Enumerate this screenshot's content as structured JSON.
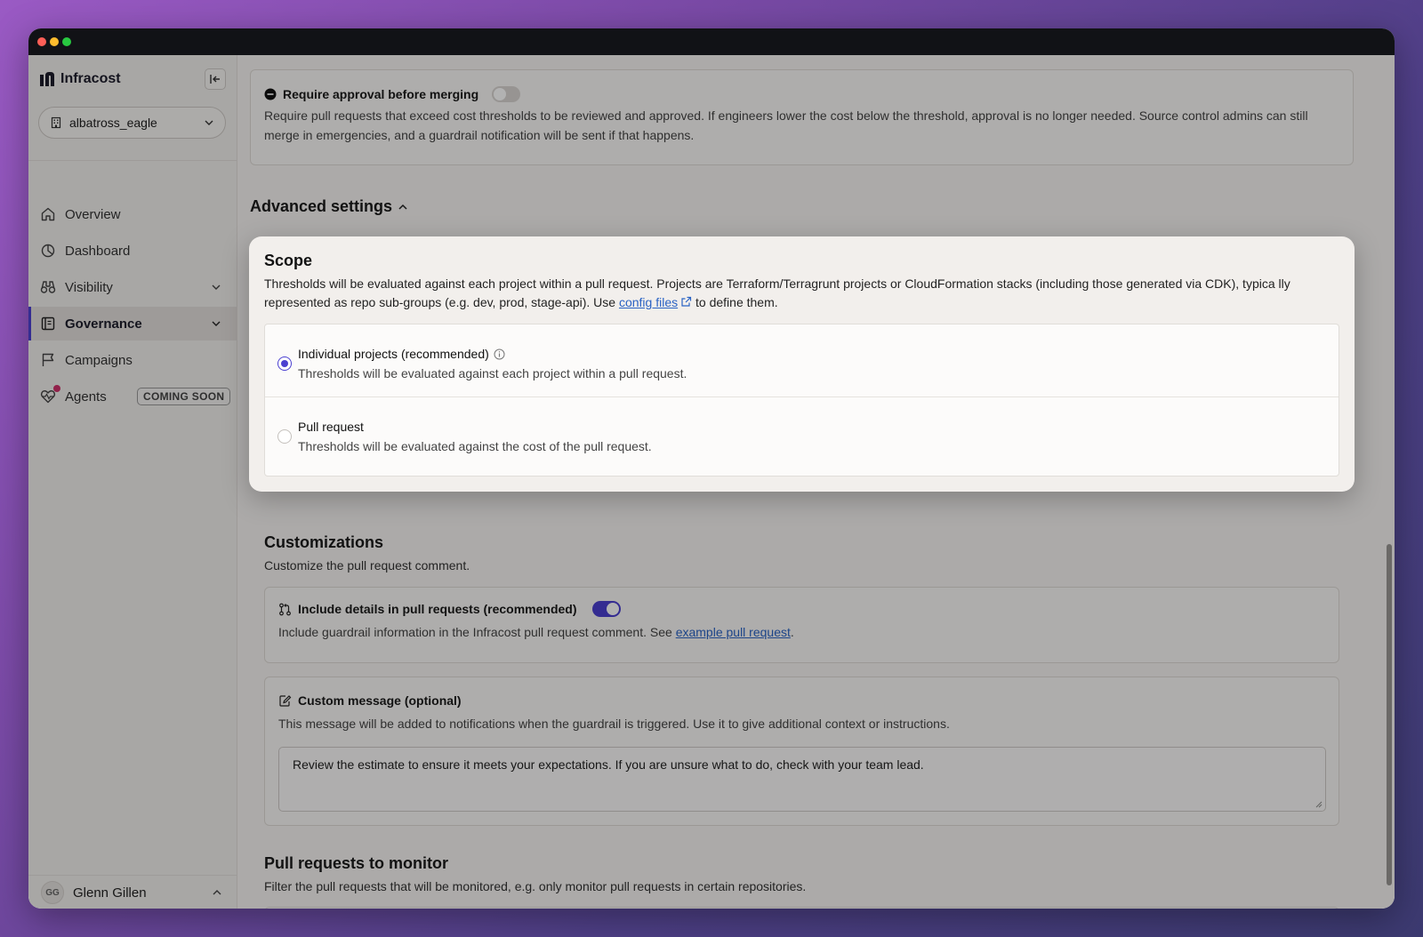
{
  "sidebar": {
    "brand": "Infracost",
    "org": "albatross_eagle",
    "items": [
      {
        "label": "Overview"
      },
      {
        "label": "Dashboard"
      },
      {
        "label": "Visibility"
      },
      {
        "label": "Governance"
      },
      {
        "label": "Campaigns"
      },
      {
        "label": "Agents",
        "badge": "COMING SOON"
      }
    ],
    "user": {
      "initials": "GG",
      "name": "Glenn Gillen"
    }
  },
  "approval": {
    "title": "Require approval before merging",
    "enabled": false,
    "description": "Require pull requests that exceed cost thresholds to be reviewed and approved. If engineers lower the cost below the threshold, approval is no longer needed. Source control admins can still merge in emergencies, and a guardrail notification will be sent if that happens."
  },
  "advanced": {
    "heading": "Advanced settings"
  },
  "scope": {
    "title": "Scope",
    "description": "Thresholds will be evaluated against each project within a pull request. Projects are Terraform/Terragrunt projects or CloudFormation stacks (including those generated via CDK), typica lly represented as repo sub-groups (e.g. dev, prod, stage-api). Use",
    "link": "config files",
    "description_end": "to define them.",
    "options": [
      {
        "label": "Individual projects (recommended)",
        "sub": "Thresholds will be evaluated against each project within a pull request.",
        "selected": true
      },
      {
        "label": "Pull request",
        "sub": "Thresholds will be evaluated against the cost of the pull request.",
        "selected": false
      }
    ]
  },
  "customizations": {
    "heading": "Customizations",
    "sub": "Customize the pull request comment.",
    "details": {
      "title": "Include details in pull requests (recommended)",
      "enabled": true,
      "desc": "Include guardrail information in the Infracost pull request comment. See",
      "link": "example pull request",
      "desc_end": "."
    },
    "custom_message": {
      "title": "Custom message (optional)",
      "desc": "This message will be added to notifications when the guardrail is triggered. Use it to give additional context or instructions.",
      "value": "Review the estimate to ensure it meets your expectations. If you are unsure what to do, check with your team lead."
    }
  },
  "monitor": {
    "heading": "Pull requests to monitor",
    "sub": "Filter the pull requests that will be monitored, e.g. only monitor pull requests in certain repositories."
  },
  "colors": {
    "accent": "#4b40d0",
    "link": "#2a63c4",
    "notification_dot": "#d0306b"
  }
}
